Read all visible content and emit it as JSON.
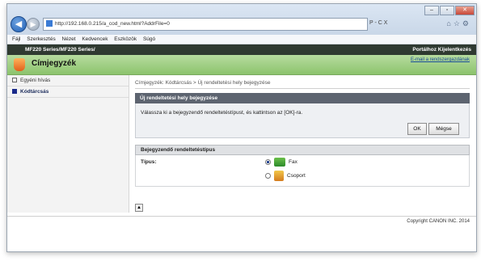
{
  "browser": {
    "address": "http://192.168.0.215/a_cod_new.html?AddrFile=0",
    "address_tools": "P - C X",
    "window_controls": {
      "minimize": "–",
      "maximize": "▫",
      "close": "✕"
    },
    "menu": [
      "Fájl",
      "Szerkesztés",
      "Nézet",
      "Kedvencek",
      "Eszközök",
      "Súgó"
    ]
  },
  "product_bar": {
    "model": "MF220 Series/MF220 Series/",
    "portal_link": "Portálhoz  Kijelentkezés"
  },
  "header": {
    "title": "Címjegyzék",
    "mail_link": "E-mail a rendszergazdának"
  },
  "sidebar": {
    "items": [
      {
        "label": "Egyéni hívás"
      },
      {
        "label": "Kódtárcsás"
      }
    ]
  },
  "main": {
    "breadcrumb": "Címjegyzék: Kódtárcsás > Új rendeltetési hely bejegyzése",
    "panel_title": "Új rendeltetési hely bejegyzése",
    "message": "Válassza ki a bejegyzendő rendeltetéstípust, és kattintson az [OK]-ra.",
    "ok_label": "OK",
    "cancel_label": "Mégse",
    "section_title": "Bejegyzendő rendeltetéstípus",
    "type_label": "Típus:",
    "options": [
      {
        "label": "Fax",
        "selected": true
      },
      {
        "label": "Csoport",
        "selected": false
      }
    ]
  },
  "footer": {
    "copyright": "Copyright CANON INC. 2014"
  },
  "colors": {
    "accent_green": "#8cc36d",
    "dark_bar": "#2f3a31",
    "panel_head": "#5d6470"
  }
}
